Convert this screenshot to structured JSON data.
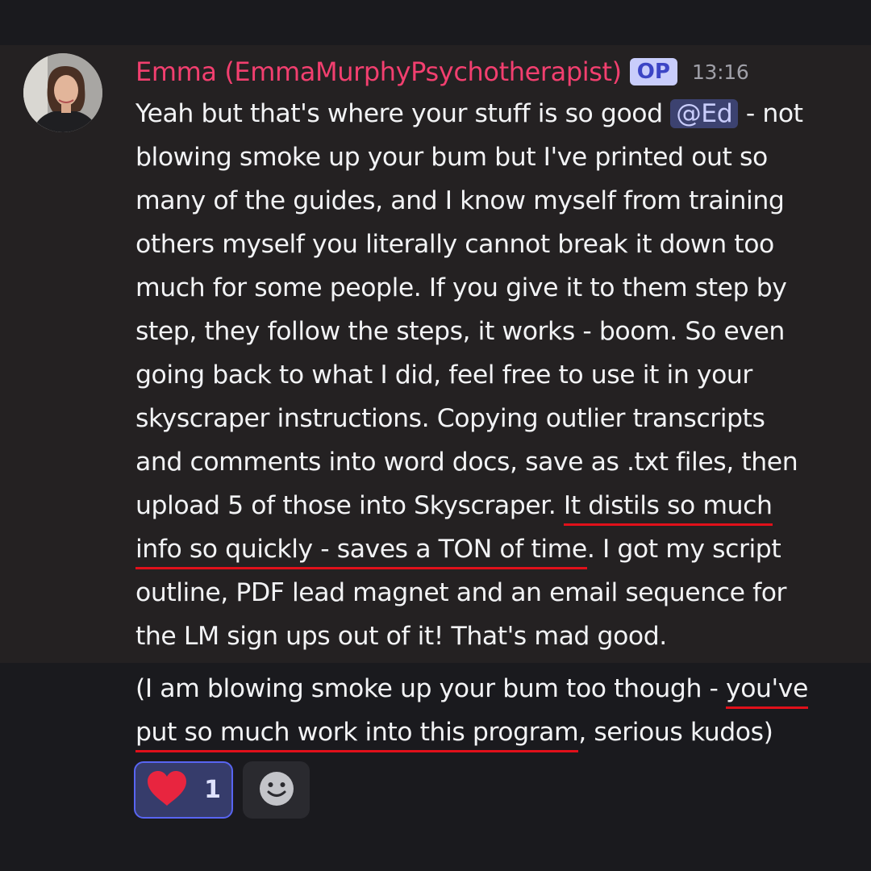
{
  "message": {
    "username": "Emma (EmmaMurphyPsychotherapist)",
    "badge": "OP",
    "timestamp": "13:16",
    "mention": "@Ed",
    "lines": [
      {
        "a": "Yeah but that's where your stuff is so good ",
        "b": " - not"
      },
      "blowing smoke up your bum but I've printed out so",
      "many of the guides, and I know myself from training",
      "others myself you literally cannot break it down too",
      "much for some people. If you give it to them step by",
      "step, they follow the steps, it works - boom. So even",
      "going back to what I did, feel free to use it in your",
      "skyscraper instructions. Copying outlier transcripts",
      "and comments into word docs, save as .txt files, then",
      {
        "a": "upload 5 of those into Skyscraper. ",
        "u": "It distils so much"
      },
      {
        "u": "info so quickly - saves a TON of time",
        "b": ". I got my script"
      },
      "outline, PDF lead magnet and an email sequence for",
      "the LM sign ups out of it! That's mad good."
    ],
    "followup_lines": [
      {
        "a": "(I am blowing smoke up your bum too though - ",
        "u": "you've"
      },
      {
        "u": "put so much work into this program",
        "b": ", serious kudos)"
      }
    ]
  },
  "reactions": [
    {
      "icon": "heart-icon",
      "count": "1",
      "selected": true
    }
  ],
  "add_reaction_icon": "smiley-icon",
  "colors": {
    "username": "#f23f6f",
    "accent": "#5865f2",
    "underline": "#e0101a",
    "highlight_bg": "#242122",
    "background": "#1a1a1e"
  }
}
